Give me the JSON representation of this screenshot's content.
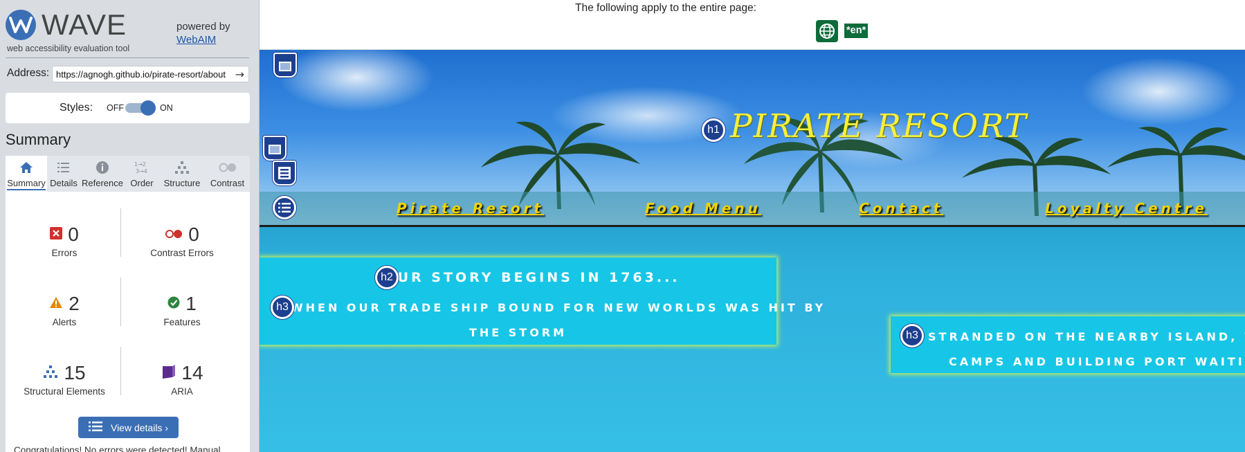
{
  "wave": {
    "logo_text": "WAVE",
    "tagline": "web accessibility evaluation tool",
    "powered_by": "powered by",
    "webaim_link": "WebAIM",
    "address_label": "Address:",
    "address_value": "https://agnogh.github.io/pirate-resort/about",
    "styles_label": "Styles:",
    "styles_off": "OFF",
    "styles_on": "ON",
    "summary_title": "Summary",
    "tabs": [
      {
        "label": "Summary",
        "icon": "home-icon",
        "active": true
      },
      {
        "label": "Details",
        "icon": "list-icon"
      },
      {
        "label": "Reference",
        "icon": "info-icon"
      },
      {
        "label": "Order",
        "icon": "order-icon"
      },
      {
        "label": "Structure",
        "icon": "structure-icon"
      },
      {
        "label": "Contrast",
        "icon": "contrast-icon"
      }
    ],
    "stats": {
      "errors": {
        "value": "0",
        "label": "Errors",
        "color": "#d0312d"
      },
      "contrast_errors": {
        "value": "0",
        "label": "Contrast Errors",
        "color": "#d0312d"
      },
      "alerts": {
        "value": "2",
        "label": "Alerts",
        "color": "#e08a00"
      },
      "features": {
        "value": "1",
        "label": "Features",
        "color": "#2e8540"
      },
      "structural": {
        "value": "15",
        "label": "Structural Elements",
        "color": "#3b6fb5"
      },
      "aria": {
        "value": "14",
        "label": "ARIA",
        "color": "#5b2c8e"
      }
    },
    "view_details": "View details ›",
    "congrats": "Congratulations! No errors were detected! Manual"
  },
  "page_top": {
    "apply_text": "The following apply to the entire page:",
    "lang_badge": "*en*"
  },
  "site": {
    "title": "PIRATE RESORT",
    "nav": [
      "Pirate Resort",
      "Food Menu",
      "Contact",
      "Loyalty Centre"
    ],
    "story_h2": "OUR STORY BEGINS IN 1763...",
    "story_h3_line1": "WHEN OUR TRADE SHIP BOUND FOR NEW WORLDS WAS HIT BY",
    "story_h3_line2": "THE STORM",
    "story2_line1": "STRANDED ON THE NEARBY ISLAND, WE ST",
    "story2_line2": "CAMPS AND BUILDING PORT WAITING FO"
  },
  "badges": {
    "h1": "h1",
    "h2": "h2",
    "h3": "h3"
  },
  "colors": {
    "wave_blue": "#3b6fb5",
    "nav_yellow": "#f2d200",
    "title_yellow": "#f7ef3a",
    "story_bg": "#17c6e6"
  }
}
